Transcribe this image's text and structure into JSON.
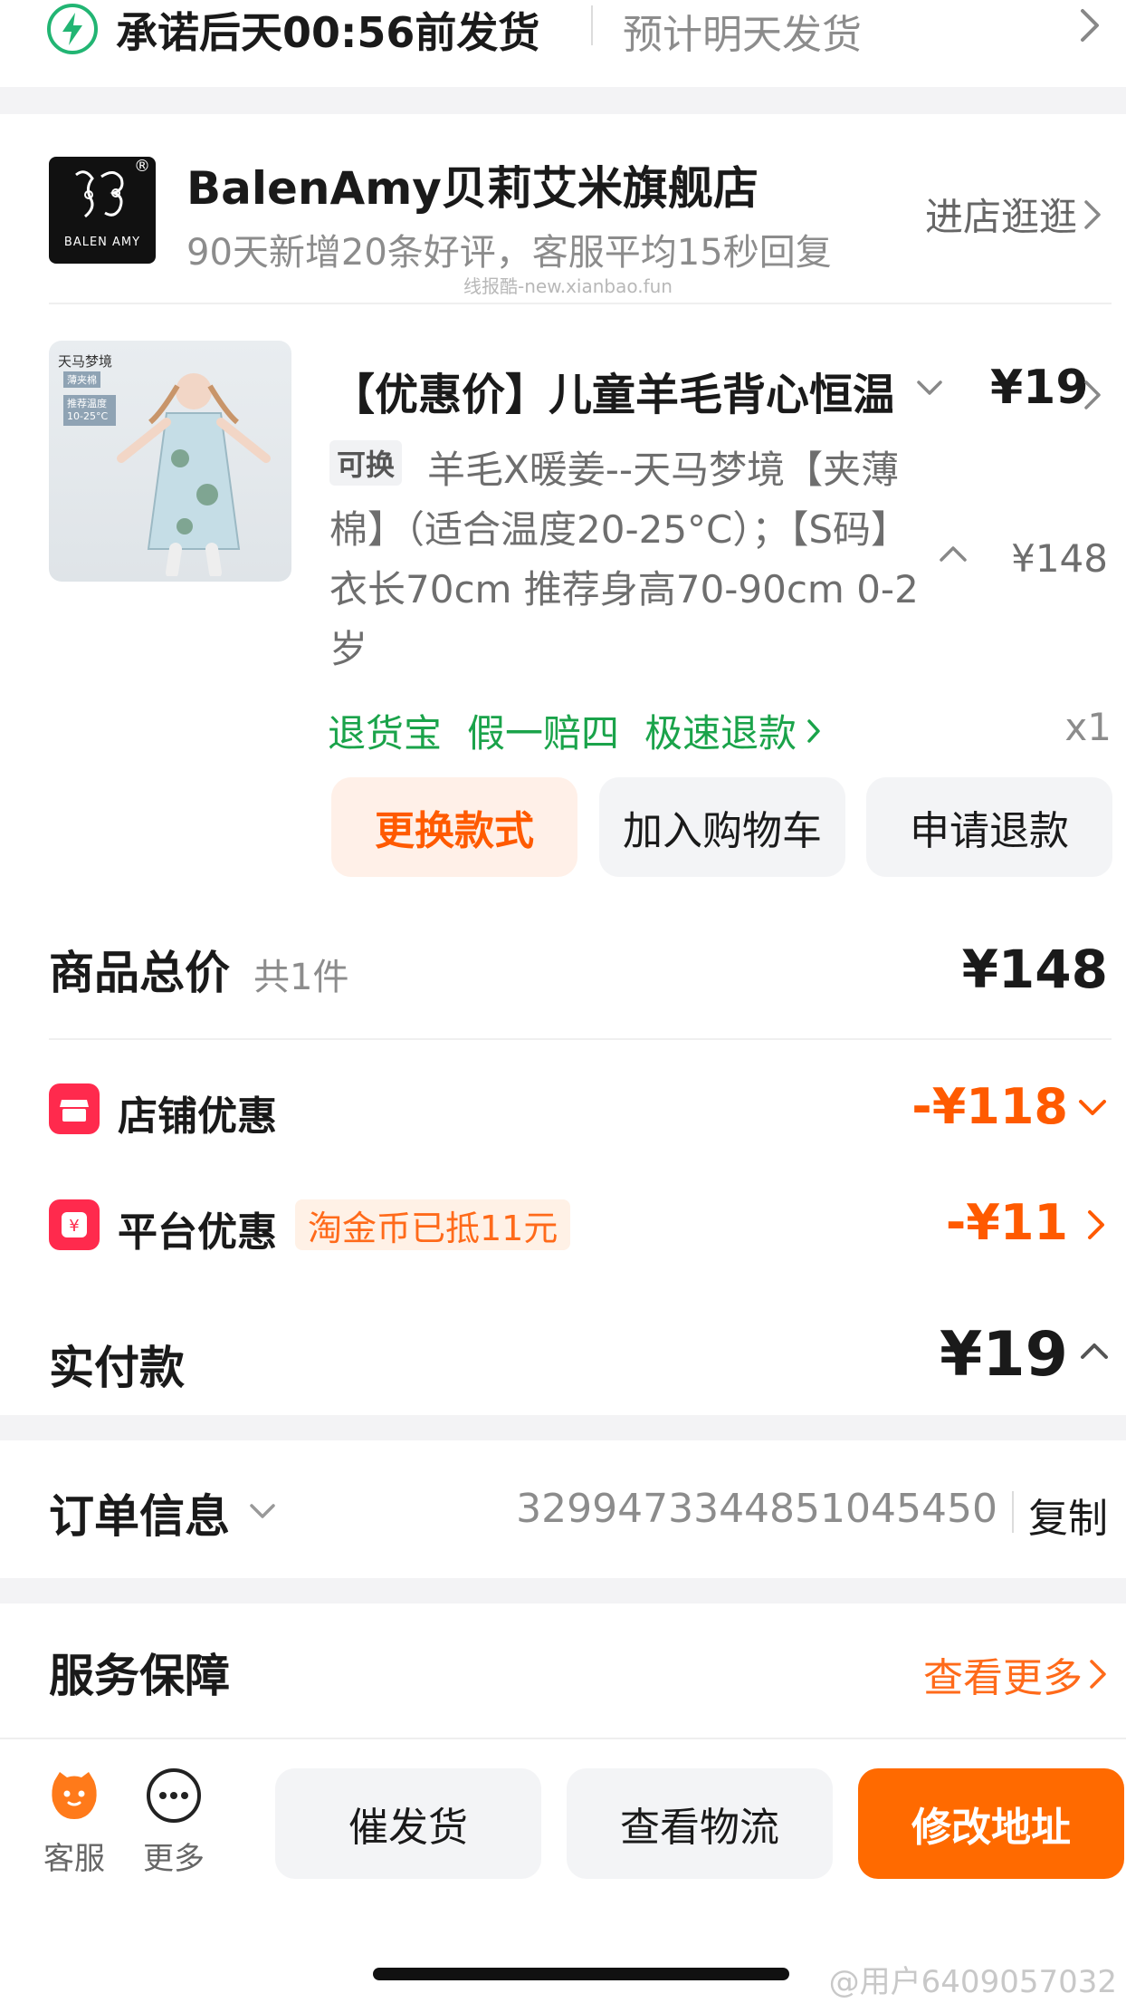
{
  "shipping": {
    "promise": "承诺后天00:56前发货",
    "estimate": "预计明天发货"
  },
  "store": {
    "logo_text": "BALEN AMY",
    "logo_mark": "®",
    "name": "BalenAmy贝莉艾米旗舰店",
    "subtitle": "90天新增20条好评，客服平均15秒回复",
    "enter_label": "进店逛逛"
  },
  "watermark": "线报酷-new.xianbao.fun",
  "product": {
    "image_tag": "天马梦境",
    "image_badge1": "薄夹棉",
    "image_badge2": "推荐温度 10-25°C",
    "title": "【优惠价】儿童羊毛背心恒温",
    "price": "¥19",
    "swap_tag": "可换",
    "spec": "羊毛X暖姜--天马梦境【夹薄棉】（适合温度20-25°C）；【S码】衣长70cm 推荐身高70-90cm 0-2岁",
    "original_price": "¥148",
    "guarantees": [
      "退货宝",
      "假一赔四",
      "极速退款"
    ],
    "quantity": "x1",
    "buttons": {
      "change_style": "更换款式",
      "add_cart": "加入购物车",
      "refund": "申请退款"
    }
  },
  "summary": {
    "total_label": "商品总价",
    "count": "共1件",
    "total_value": "¥148",
    "store_discount_label": "店铺优惠",
    "store_discount_value": "-¥118",
    "platform_discount_label": "平台优惠",
    "coin_tag": "淘金币已抵11元",
    "platform_discount_value": "-¥11",
    "paid_label": "实付款",
    "paid_value": "¥19"
  },
  "order_info": {
    "label": "订单信息",
    "number": "3299473344851045450",
    "copy_label": "复制"
  },
  "service": {
    "label": "服务保障",
    "more_label": "查看更多"
  },
  "bottom_bar": {
    "service_label": "客服",
    "more_label": "更多",
    "urge_label": "催发货",
    "logistics_label": "查看物流",
    "modify_label": "修改地址"
  },
  "weibo_mark": "@用户6409057032",
  "colors": {
    "accent": "#ff6a00",
    "green": "#1aa34a",
    "discount_red": "#ff2a4d",
    "coin_bg": "#fff1e6"
  }
}
